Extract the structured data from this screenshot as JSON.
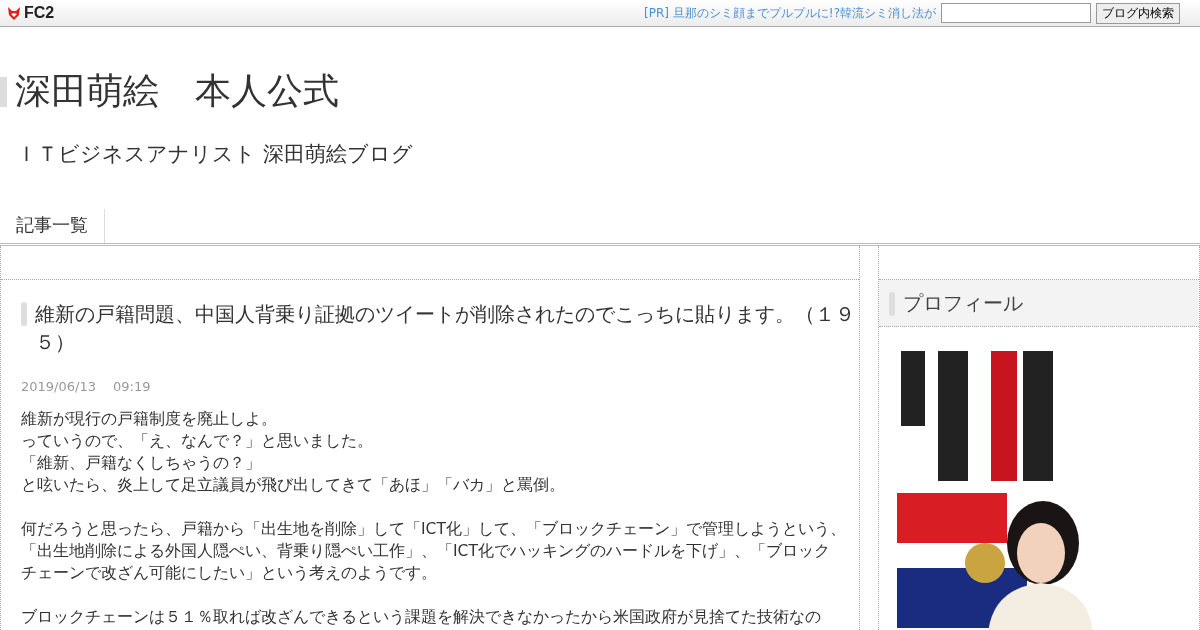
{
  "top_bar": {
    "logo": "FC2",
    "ad_link": "[PR] 旦那のシミ顔までプルプルに!?韓流シミ消し法が",
    "search": {
      "button": "ブログ内検索"
    }
  },
  "header": {
    "title": "深田萌絵　本人公式",
    "subtitle": "ＩＴビジネスアナリスト 深田萌絵ブログ"
  },
  "nav": [
    {
      "label": "記事一覧"
    }
  ],
  "post": {
    "title": "維新の戸籍問題、中国人背乗り証拠のツイートが削除されたのでこっちに貼ります。（１９５）",
    "date": "2019/06/13　 09:19",
    "paragraphs": [
      [
        "維新が現行の戸籍制度を廃止しよ。",
        "っていうので、「え、なんで？」と思いました。",
        "「維新、戸籍なくしちゃうの？」",
        "と呟いたら、炎上して足立議員が飛び出してきて「あほ」「バカ」と罵倒。"
      ],
      [
        "何だろうと思ったら、戸籍から「出生地を削除」して「ICT化」して、「ブロックチェーン」で管理しようという、",
        "「出生地削除による外国人隠ぺい、背乗り隠ぺい工作」、「ICT化でハッキングのハードルを下げ」、「ブロック",
        "チェーンで改ざん可能にしたい」という考えのようです。"
      ],
      [
        "ブロックチェーンは５１％取れば改ざんできるという課題を解決できなかったから米国政府が見捨てた技術なの"
      ]
    ]
  },
  "sidebar": {
    "heading": "プロフィール"
  }
}
